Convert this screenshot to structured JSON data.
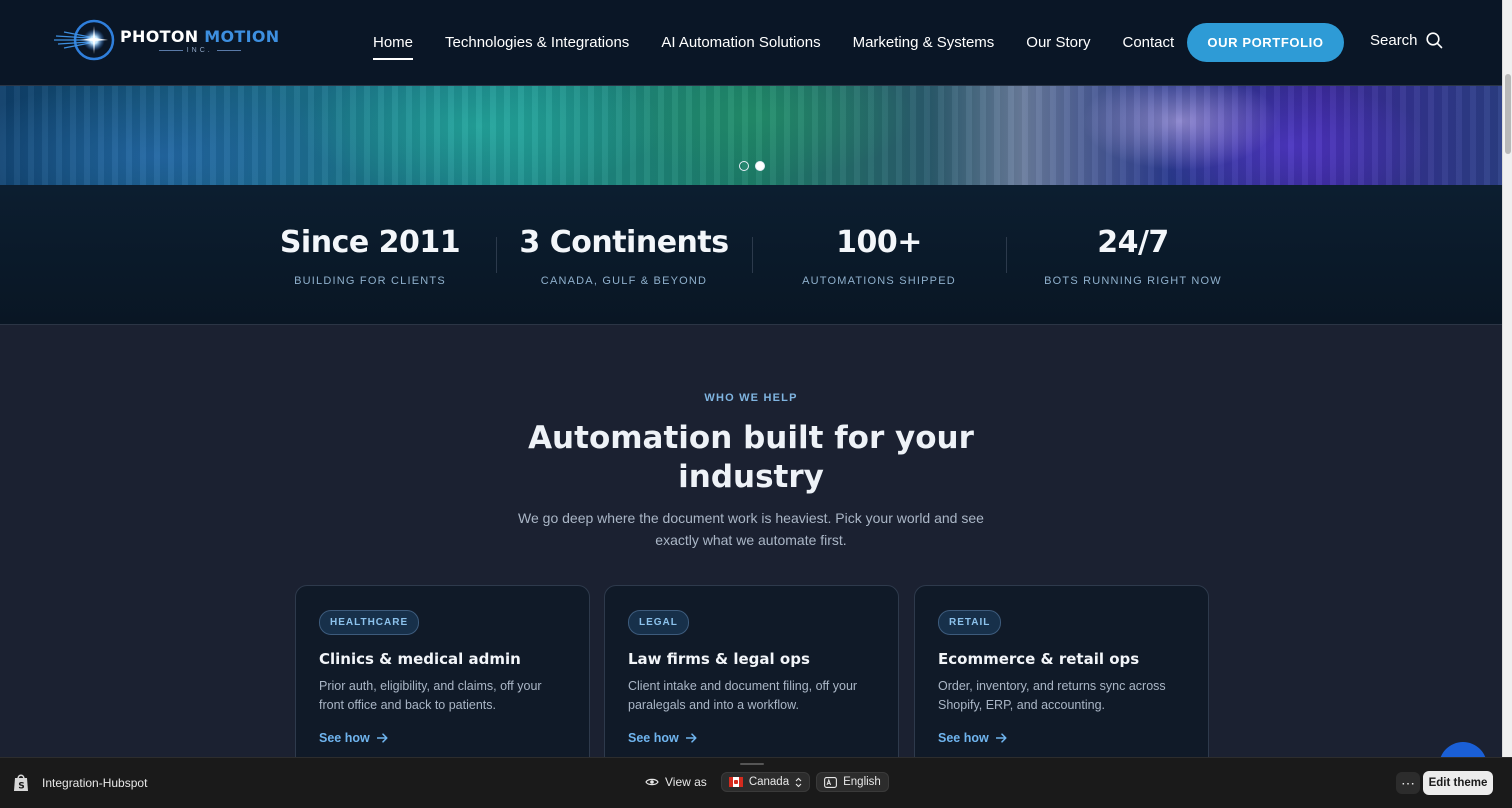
{
  "brand": {
    "name_part1": "PHOTON ",
    "name_part2": "MOTION",
    "tagline": "INC."
  },
  "nav": {
    "items": [
      {
        "label": "Home",
        "active": true
      },
      {
        "label": "Technologies & Integrations",
        "active": false
      },
      {
        "label": "AI Automation Solutions",
        "active": false
      },
      {
        "label": "Marketing & Systems",
        "active": false
      },
      {
        "label": "Our Story",
        "active": false
      },
      {
        "label": "Contact",
        "active": false
      }
    ],
    "portfolio_button": "OUR PORTFOLIO",
    "search_label": "Search"
  },
  "hero": {
    "slide_count": 2,
    "active_slide": 2
  },
  "stats": [
    {
      "value": "Since 2011",
      "label": "BUILDING FOR CLIENTS"
    },
    {
      "value": "3 Continents",
      "label": "CANADA, GULF & BEYOND"
    },
    {
      "value": "100+",
      "label": "AUTOMATIONS SHIPPED"
    },
    {
      "value": "24/7",
      "label": "BOTS RUNNING RIGHT NOW"
    }
  ],
  "industries": {
    "eyebrow": "WHO WE HELP",
    "heading": "Automation built for your industry",
    "subtext": "We go deep where the document work is heaviest. Pick your world and see exactly what we automate first.",
    "cards": [
      {
        "tag": "HEALTHCARE",
        "title": "Clinics & medical admin",
        "description": "Prior auth, eligibility, and claims, off your front office and back to patients.",
        "link": "See how"
      },
      {
        "tag": "LEGAL",
        "title": "Law firms & legal ops",
        "description": "Client intake and document filing, off your paralegals and into a workflow.",
        "link": "See how"
      },
      {
        "tag": "RETAIL",
        "title": "Ecommerce & retail ops",
        "description": "Order, inventory, and returns sync across Shopify, ERP, and accounting.",
        "link": "See how"
      }
    ]
  },
  "preview_bar": {
    "store_name": "Integration-Hubspot",
    "view_as_label": "View as",
    "country": "Canada",
    "language": "English",
    "edit_button": "Edit theme"
  },
  "colors": {
    "accent": "#2e9bd6",
    "header_bg": "#0a1626",
    "section_bg": "#1b2131",
    "link": "#6fb4ee"
  }
}
